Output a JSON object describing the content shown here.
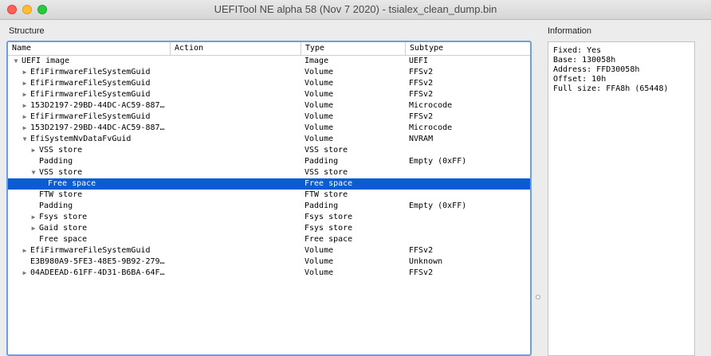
{
  "window": {
    "title": "UEFITool NE alpha 58 (Nov  7 2020) - tsialex_clean_dump.bin"
  },
  "structure": {
    "label": "Structure",
    "columns": [
      "Name",
      "Action",
      "Type",
      "Subtype"
    ],
    "rows": [
      {
        "name": "UEFI image",
        "action": "",
        "type": "Image",
        "subtype": "UEFI",
        "depth": 0,
        "expander": "down",
        "selected": false
      },
      {
        "name": "EfiFirmwareFileSystemGuid",
        "action": "",
        "type": "Volume",
        "subtype": "FFSv2",
        "depth": 1,
        "expander": "right",
        "selected": false
      },
      {
        "name": "EfiFirmwareFileSystemGuid",
        "action": "",
        "type": "Volume",
        "subtype": "FFSv2",
        "depth": 1,
        "expander": "right",
        "selected": false
      },
      {
        "name": "EfiFirmwareFileSystemGuid",
        "action": "",
        "type": "Volume",
        "subtype": "FFSv2",
        "depth": 1,
        "expander": "right",
        "selected": false
      },
      {
        "name": "153D2197-29BD-44DC-AC59-887…",
        "action": "",
        "type": "Volume",
        "subtype": "Microcode",
        "depth": 1,
        "expander": "right",
        "selected": false
      },
      {
        "name": "EfiFirmwareFileSystemGuid",
        "action": "",
        "type": "Volume",
        "subtype": "FFSv2",
        "depth": 1,
        "expander": "right",
        "selected": false
      },
      {
        "name": "153D2197-29BD-44DC-AC59-887…",
        "action": "",
        "type": "Volume",
        "subtype": "Microcode",
        "depth": 1,
        "expander": "right",
        "selected": false
      },
      {
        "name": "EfiSystemNvDataFvGuid",
        "action": "",
        "type": "Volume",
        "subtype": "NVRAM",
        "depth": 1,
        "expander": "down",
        "selected": false
      },
      {
        "name": "VSS store",
        "action": "",
        "type": "VSS store",
        "subtype": "",
        "depth": 2,
        "expander": "right",
        "selected": false
      },
      {
        "name": "Padding",
        "action": "",
        "type": "Padding",
        "subtype": "Empty (0xFF)",
        "depth": 2,
        "expander": "",
        "selected": false
      },
      {
        "name": "VSS store",
        "action": "",
        "type": "VSS store",
        "subtype": "",
        "depth": 2,
        "expander": "down",
        "selected": false
      },
      {
        "name": "Free space",
        "action": "",
        "type": "Free space",
        "subtype": "",
        "depth": 3,
        "expander": "",
        "selected": true
      },
      {
        "name": "FTW store",
        "action": "",
        "type": "FTW store",
        "subtype": "",
        "depth": 2,
        "expander": "",
        "selected": false
      },
      {
        "name": "Padding",
        "action": "",
        "type": "Padding",
        "subtype": "Empty (0xFF)",
        "depth": 2,
        "expander": "",
        "selected": false
      },
      {
        "name": "Fsys store",
        "action": "",
        "type": "Fsys store",
        "subtype": "",
        "depth": 2,
        "expander": "right",
        "selected": false
      },
      {
        "name": "Gaid store",
        "action": "",
        "type": "Fsys store",
        "subtype": "",
        "depth": 2,
        "expander": "right",
        "selected": false
      },
      {
        "name": "Free space",
        "action": "",
        "type": "Free space",
        "subtype": "",
        "depth": 2,
        "expander": "",
        "selected": false
      },
      {
        "name": "EfiFirmwareFileSystemGuid",
        "action": "",
        "type": "Volume",
        "subtype": "FFSv2",
        "depth": 1,
        "expander": "right",
        "selected": false
      },
      {
        "name": "E3B980A9-5FE3-48E5-9B92-279…",
        "action": "",
        "type": "Volume",
        "subtype": "Unknown",
        "depth": 1,
        "expander": "",
        "selected": false
      },
      {
        "name": "04ADEEAD-61FF-4D31-B6BA-64F…",
        "action": "",
        "type": "Volume",
        "subtype": "FFSv2",
        "depth": 1,
        "expander": "right",
        "selected": false
      }
    ]
  },
  "information": {
    "label": "Information",
    "lines": [
      "Fixed: Yes",
      "Base: 130058h",
      "Address: FFD30058h",
      "Offset: 10h",
      "Full size: FFA8h (65448)"
    ]
  }
}
